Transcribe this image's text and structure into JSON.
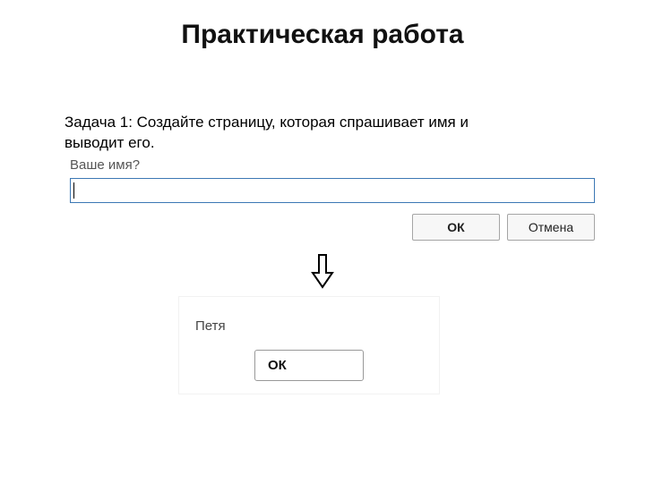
{
  "title": "Практическая работа",
  "task": "Задача 1:  Создайте страницу, которая спрашивает имя и выводит его.",
  "prompt": {
    "label": "Ваше имя?",
    "value": "",
    "ok": "ОК",
    "cancel": "Отмена"
  },
  "arrow": "⇩",
  "alert": {
    "message": "Петя",
    "ok": "ОК"
  }
}
